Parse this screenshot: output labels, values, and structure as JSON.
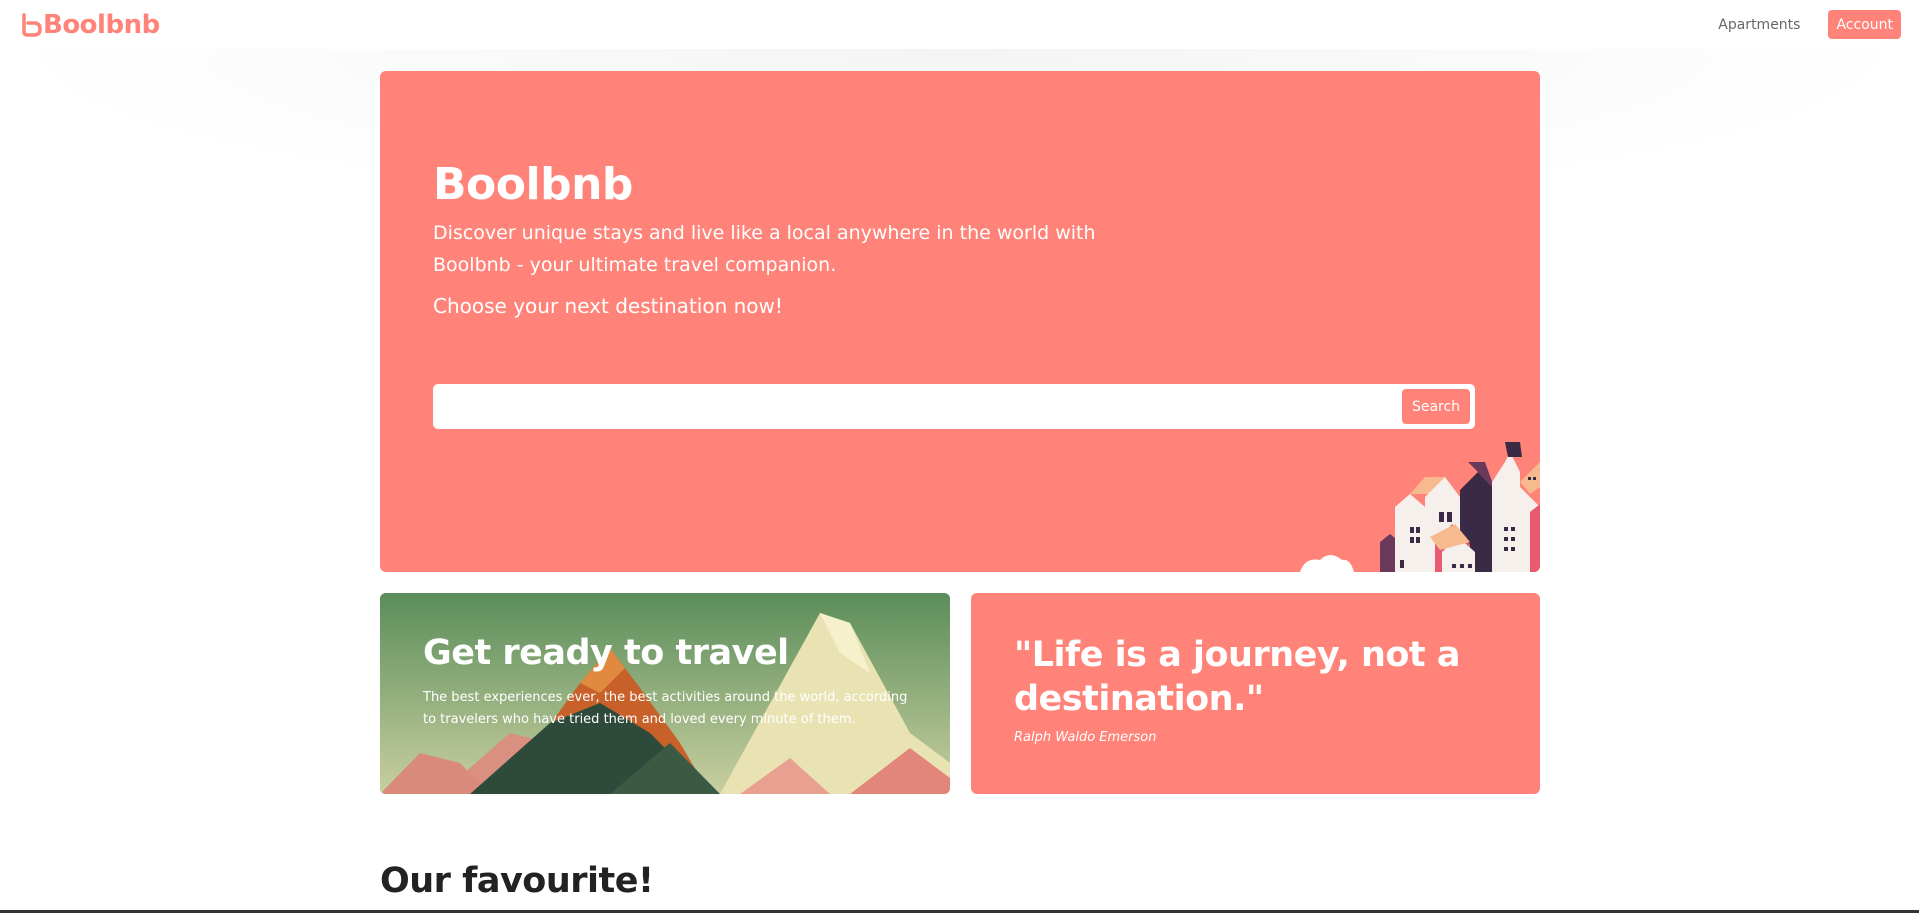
{
  "brand": {
    "name": "Boolbnb",
    "color": "#ff8378"
  },
  "nav": {
    "apartments_label": "Apartments",
    "account_label": "Account"
  },
  "hero": {
    "title": "Boolbnb",
    "description": "Discover unique stays and live like a local anywhere in the world with Boolbnb - your ultimate travel companion.",
    "cta": "Choose your next destination now!",
    "search": {
      "value": "",
      "placeholder": "",
      "button_label": "Search"
    }
  },
  "cards": {
    "travel": {
      "title": "Get ready to travel",
      "text": "The best experiences ever, the best activities around the world, according to travelers who have tried them and loved every minute of them."
    },
    "quote": {
      "text": "\"Life is a journey, not a destination.\"",
      "author": "Ralph Waldo Emerson"
    }
  },
  "favourites": {
    "title": "Our favourite!"
  }
}
